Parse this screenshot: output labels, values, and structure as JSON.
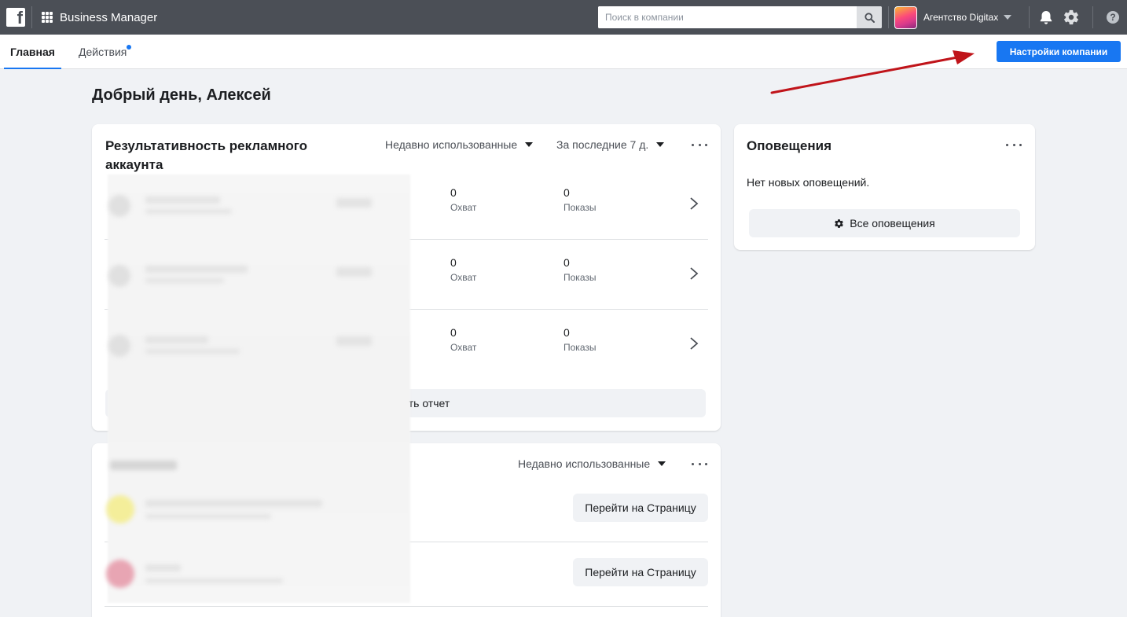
{
  "topbar": {
    "logo_letter": "f",
    "app_title": "Business Manager",
    "search_placeholder": "Поиск в компании",
    "account_name": "Агентство Digitax",
    "icons": [
      "facebook-logo",
      "apps-grid-icon",
      "search-icon",
      "chevron-down-icon",
      "bell-icon",
      "gear-icon",
      "help-icon"
    ]
  },
  "subnav": {
    "tabs": [
      {
        "label": "Главная",
        "active": true
      },
      {
        "label": "Действия",
        "active": false,
        "has_notification_dot": true
      }
    ],
    "settings_button": "Настройки компании"
  },
  "greeting": "Добрый день, Алексей",
  "ad_performance": {
    "title": "Результативность рекламного аккаунта",
    "filter_recent": "Недавно использованные",
    "filter_period": "За последние 7 д.",
    "rows": [
      {
        "reach_value": "0",
        "reach_label": "Охват",
        "impressions_value": "0",
        "impressions_label": "Показы"
      },
      {
        "reach_value": "0",
        "reach_label": "Охват",
        "impressions_value": "0",
        "impressions_label": "Показы"
      },
      {
        "reach_value": "0",
        "reach_label": "Охват",
        "impressions_value": "0",
        "impressions_label": "Показы"
      }
    ],
    "report_button_partial": "ть отчет"
  },
  "pages_card": {
    "filter_recent": "Недавно использованные",
    "rows": [
      {
        "button": "Перейти на Страницу"
      },
      {
        "button": "Перейти на Страницу"
      }
    ]
  },
  "notifications": {
    "title": "Оповещения",
    "empty_text": "Нет новых оповещений.",
    "all_button": "Все оповещения"
  },
  "colors": {
    "topbar": "#4b4f56",
    "primary": "#1877f2",
    "annotation_arrow": "#c0141a"
  }
}
